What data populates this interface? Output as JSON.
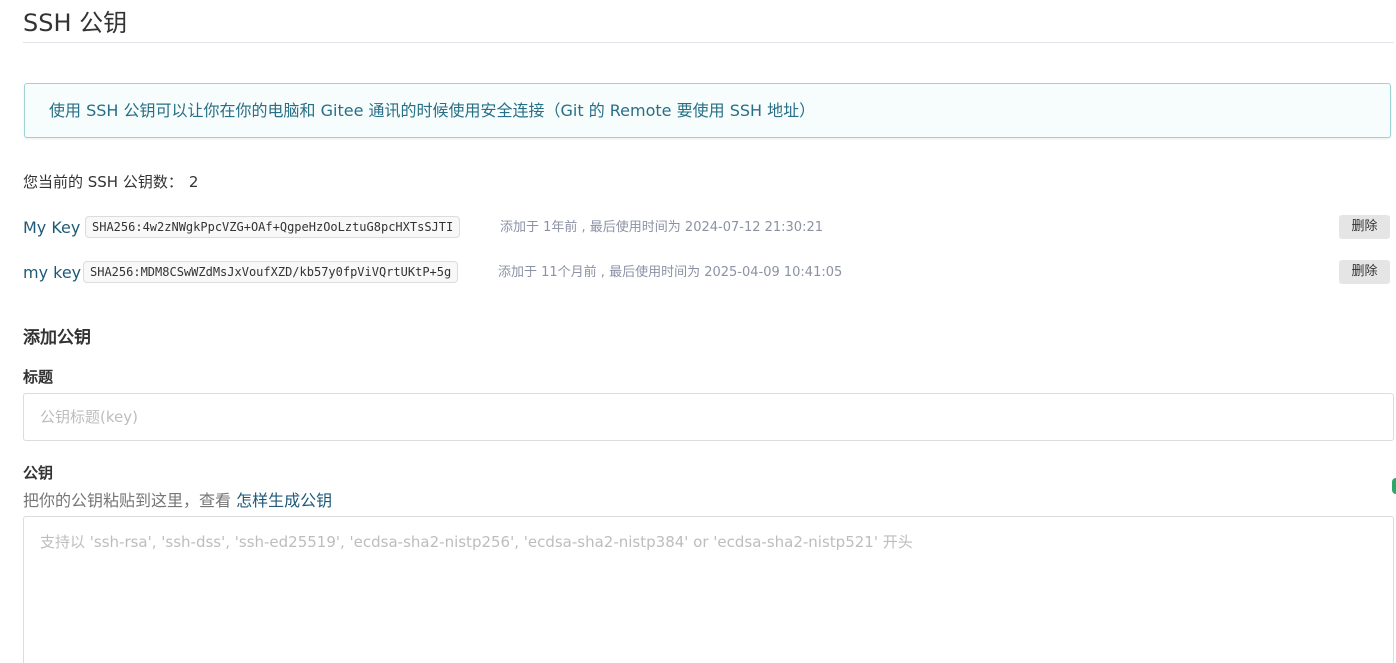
{
  "page": {
    "title": "SSH 公钥"
  },
  "info": {
    "text": "使用 SSH 公钥可以让你在你的电脑和 Gitee 通讯的时候使用安全连接（Git 的 Remote 要使用 SSH 地址）"
  },
  "summary": {
    "label": "您当前的 SSH 公钥数：",
    "count": "2"
  },
  "keys": [
    {
      "name": "My Key",
      "fingerprint": "SHA256:4w2zNWgkPpcVZG+OAf+QgpeHzOoLztuG8pcHXTsSJTI",
      "meta": "添加于 1年前 , 最后使用时间为 2024-07-12 21:30:21",
      "delete_label": "删除"
    },
    {
      "name": "my key",
      "fingerprint": "SHA256:MDM8CSwWZdMsJxVoufXZD/kb57y0fpViVQrtUKtP+5g",
      "meta": "添加于 11个月前 , 最后使用时间为 2025-04-09 10:41:05",
      "delete_label": "删除"
    }
  ],
  "add_section": {
    "title": "添加公钥",
    "title_field": {
      "label": "标题",
      "value": "",
      "placeholder": "公钥标题(key)"
    },
    "key_field": {
      "label": "公钥",
      "hint": "把你的公钥粘贴到这里，查看",
      "hint_link": "怎样生成公钥",
      "value": "",
      "placeholder": "支持以 'ssh-rsa', 'ssh-dss', 'ssh-ed25519', 'ecdsa-sha2-nistp256', 'ecdsa-sha2-nistp384' or 'ecdsa-sha2-nistp521' 开头"
    }
  },
  "colors": {
    "link": "#1e5a78",
    "info_text": "#276f86",
    "info_border": "#9dd4d2",
    "info_bg": "#f7fcfc",
    "meta_text": "#8c92a4",
    "button_bg": "#e5e5e5"
  }
}
